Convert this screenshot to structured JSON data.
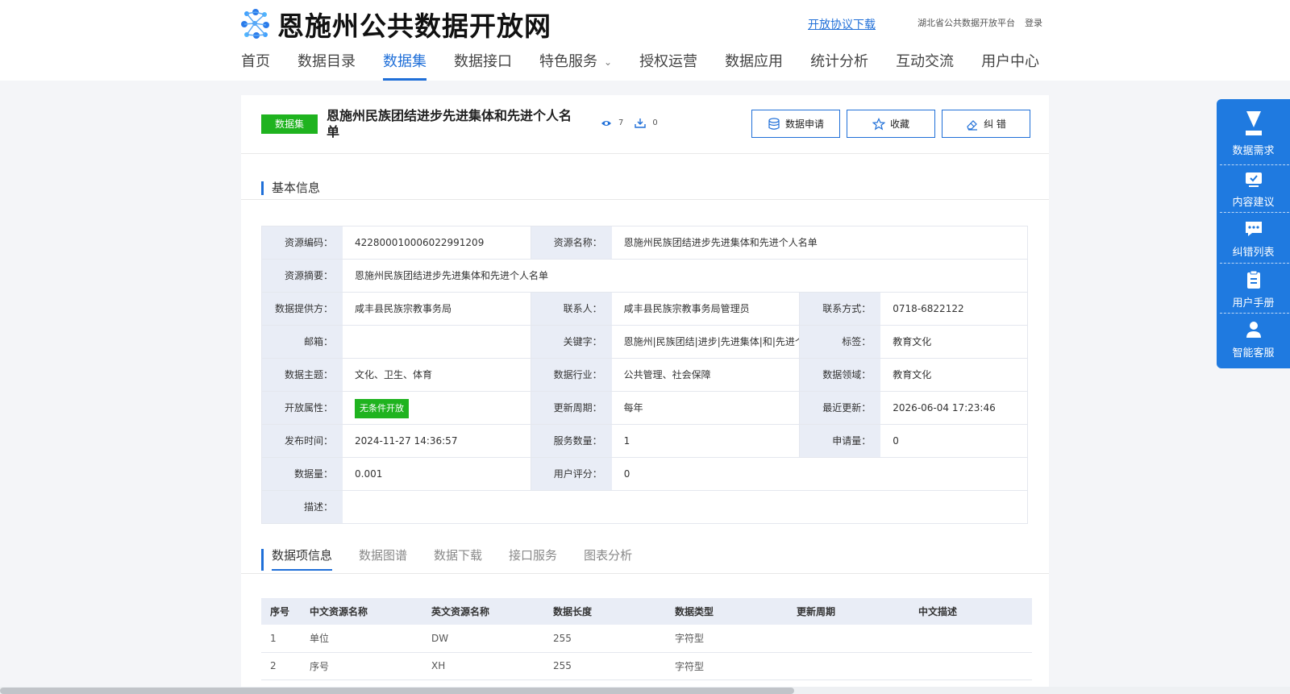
{
  "site": {
    "title": "恩施州公共数据开放网",
    "agreement_link": "开放协议下载",
    "platform_link": "湖北省公共数据开放平台",
    "login_link": "登录"
  },
  "nav": [
    {
      "label": "首页",
      "active": false
    },
    {
      "label": "数据目录",
      "active": false
    },
    {
      "label": "数据集",
      "active": true
    },
    {
      "label": "数据接口",
      "active": false
    },
    {
      "label": "特色服务",
      "active": false,
      "dropdown": true
    },
    {
      "label": "授权运营",
      "active": false
    },
    {
      "label": "数据应用",
      "active": false
    },
    {
      "label": "统计分析",
      "active": false
    },
    {
      "label": "互动交流",
      "active": false
    },
    {
      "label": "用户中心",
      "active": false
    }
  ],
  "dataset": {
    "badge": "数据集",
    "title": "恩施州民族团结进步先进集体和先进个人名单",
    "views": "7",
    "downloads": "0"
  },
  "actions": {
    "apply": "数据申请",
    "favorite": "收藏",
    "correct": "纠 错"
  },
  "basic_info": {
    "heading": "基本信息",
    "fields": {
      "code_label": "资源编码：",
      "code": "42280001000602299120​9",
      "name_label": "资源名称：",
      "name": "恩施州民族团结进步先进集体和先进个人名单",
      "abstract_label": "资源摘要：",
      "abstract": "恩施州民族团结进步先进集体和先进个人名单",
      "provider_label": "数据提供方：",
      "provider": "咸丰县民族宗教事务局",
      "contact_label": "联系人：",
      "contact": "咸丰县民族宗教事务局管理员",
      "phone_label": "联系方式：",
      "phone": "0718-6822122",
      "email_label": "邮箱：",
      "email": "",
      "keywords_label": "关键字：",
      "keywords": "恩施州|民族团结|进步|先进集体|和|先进个人",
      "tags_label": "标签：",
      "tags": "教育文化",
      "theme_label": "数据主题：",
      "theme": "文化、卫生、体育",
      "industry_label": "数据行业：",
      "industry": "公共管理、社会保障",
      "domain_label": "数据领域：",
      "domain": "教育文化",
      "open_label": "开放属性：",
      "open": "无条件开放",
      "cycle_label": "更新周期：",
      "cycle": "每年",
      "updated_label": "最近更新：",
      "updated": "2026-06-04 17:23:46",
      "published_label": "发布时间：",
      "published": "2024-11-27 14:36:57",
      "services_label": "服务数量：",
      "services": "1",
      "applications_label": "申请量：",
      "applications": "0",
      "volume_label": "数据量：",
      "volume": "0.001",
      "rating_label": "用户评分：",
      "rating": "0",
      "desc_label": "描述：",
      "desc": ""
    }
  },
  "tabs": [
    "数据项信息",
    "数据图谱",
    "数据下载",
    "接口服务",
    "图表分析"
  ],
  "table": {
    "headers": [
      "序号",
      "中文资源名称",
      "英文资源名称",
      "数据长度",
      "数据类型",
      "更新周期",
      "中文描述"
    ],
    "rows": [
      [
        "1",
        "单位",
        "DW",
        "255",
        "字符型",
        "",
        ""
      ],
      [
        "2",
        "序号",
        "XH",
        "255",
        "字符型",
        "",
        ""
      ]
    ]
  },
  "float_panel": [
    "数据需求",
    "内容建议",
    "纠错列表",
    "用户手册",
    "智能客服"
  ],
  "colors": {
    "primary": "#1f6fd8",
    "badge_green": "#1fb31f",
    "float_blue": "#1f7ae0"
  }
}
